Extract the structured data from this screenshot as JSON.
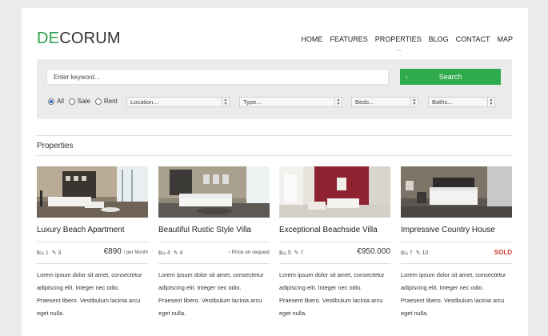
{
  "logo": {
    "accent": "DE",
    "rest": "CORUM",
    "accent_color": "#2d9f4e"
  },
  "nav": [
    "HOME",
    "FEATURES",
    "PROPERTIES",
    "BLOG",
    "CONTACT",
    "MAP"
  ],
  "search": {
    "keyword_value": "Enter keyword...",
    "button_label": "Search",
    "button_color": "#2faa4d",
    "modes": [
      {
        "label": "All",
        "checked": true
      },
      {
        "label": "Sale",
        "checked": false
      },
      {
        "label": "Rent",
        "checked": false
      }
    ],
    "selects": [
      "Location...",
      "Type...",
      "Beds...",
      "Baths..."
    ]
  },
  "section_title": "Properties",
  "properties": [
    {
      "title": "Luxury Beach Apartment",
      "beds": "1",
      "baths": "3",
      "price": "€890",
      "price_suffix": "/ per Month",
      "status": ""
    },
    {
      "title": "Beautiful Rustic Style Villa",
      "beds": "4",
      "baths": "4",
      "price": "",
      "price_suffix": "",
      "status": "Price on request"
    },
    {
      "title": "Exceptional Beachside Villa",
      "beds": "5",
      "baths": "7",
      "price": "€950.000",
      "price_suffix": "",
      "status": ""
    },
    {
      "title": "Impressive Country House",
      "beds": "7",
      "baths": "10",
      "price": "",
      "price_suffix": "",
      "status": "SOLD"
    }
  ],
  "description_lines": [
    "Lorem ipsum dolor sit amet, consectetur",
    "adipiscing elit. Integer nec odio.",
    "Praesent libero. Vestibulum lacinia arcu",
    "eget nulla."
  ]
}
